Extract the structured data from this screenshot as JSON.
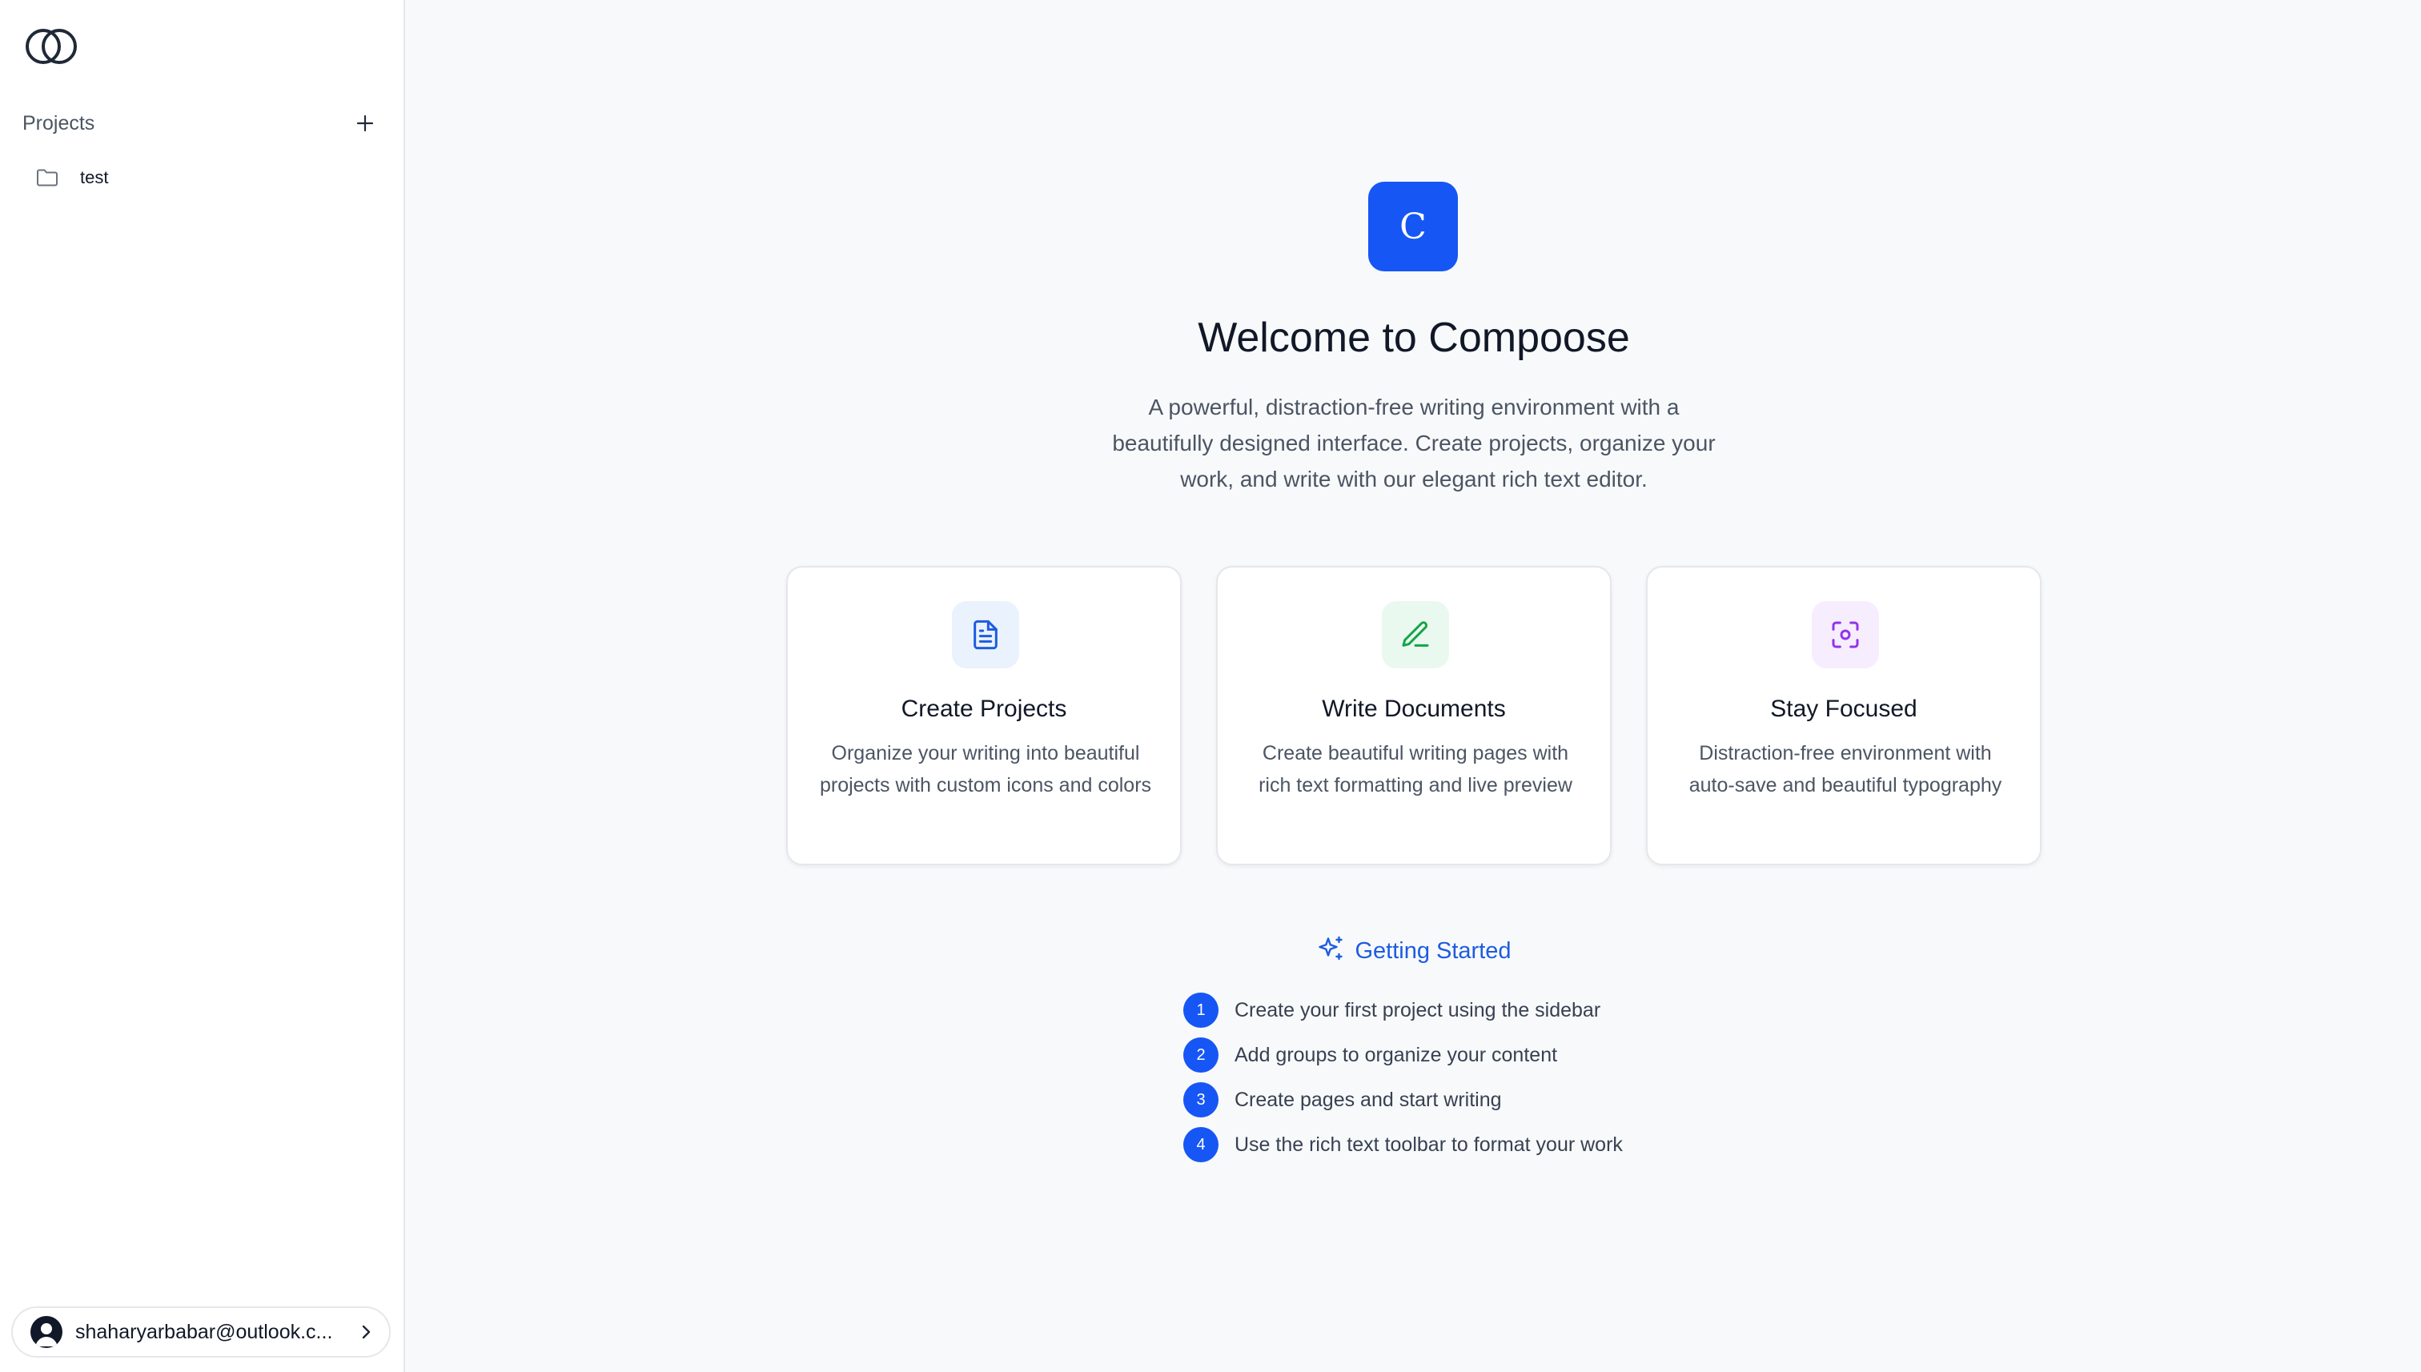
{
  "sidebar": {
    "logo_icon": "interlocking-circles-icon",
    "projects_label": "Projects",
    "add_icon": "plus-icon",
    "projects": [
      {
        "name": "test",
        "icon": "folder-icon"
      }
    ],
    "user": {
      "email": "shaharyarbabar@outlook.c...",
      "avatar_icon": "user-avatar-icon",
      "chevron_icon": "chevron-right-icon"
    }
  },
  "main": {
    "brand_letter": "C",
    "title": "Welcome to Compoose",
    "subtitle": "A powerful, distraction-free writing environment with a beautifully designed interface. Create projects, organize your work, and write with our elegant rich text editor.",
    "cards": [
      {
        "icon": "document-icon",
        "title": "Create Projects",
        "description": "Organize your writing into beautiful projects with custom icons and colors",
        "icon_color": "#1d5ce0",
        "icon_bg": "#eaf2fe"
      },
      {
        "icon": "pencil-icon",
        "title": "Write Documents",
        "description": "Create beautiful writing pages with rich text formatting and live preview",
        "icon_color": "#16a34a",
        "icon_bg": "#e9f9ef"
      },
      {
        "icon": "focus-icon",
        "title": "Stay Focused",
        "description": "Distraction-free environment with auto-save and beautiful typography",
        "icon_color": "#9333ea",
        "icon_bg": "#f6eefe"
      }
    ],
    "getting_started": {
      "icon": "sparkles-icon",
      "title": "Getting Started",
      "steps": [
        {
          "number": "1",
          "text": "Create your first project using the sidebar"
        },
        {
          "number": "2",
          "text": "Add groups to organize your content"
        },
        {
          "number": "3",
          "text": "Create pages and start writing"
        },
        {
          "number": "4",
          "text": "Use the rich text toolbar to format your work"
        }
      ]
    }
  },
  "colors": {
    "accent": "#1656f5",
    "link": "#1d5ce0",
    "background": "#f8f9fb"
  }
}
